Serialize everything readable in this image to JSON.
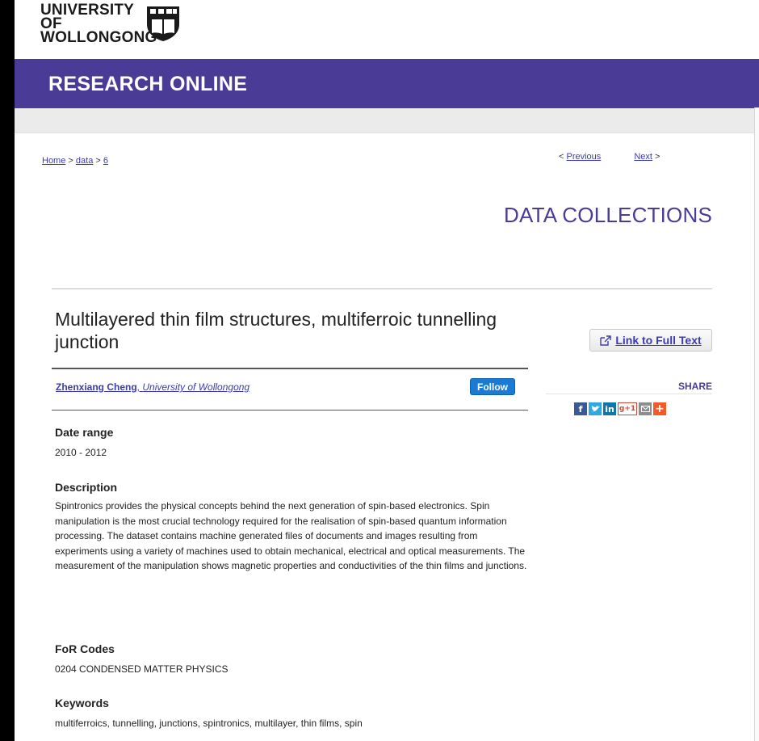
{
  "header": {
    "logo_line1": "UNIVERSITY OF",
    "logo_line2": "WOLLONGONG",
    "banner_title": "RESEARCH ONLINE"
  },
  "breadcrumb": {
    "home": "Home",
    "sep1": ">",
    "data": "data",
    "sep2": ">",
    "item": "6"
  },
  "pager": {
    "prev_prefix": "<",
    "previous": "Previous",
    "next": "Next",
    "next_suffix": ">"
  },
  "section_title": "DATA COLLECTIONS",
  "item": {
    "title": "Multilayered thin film structures, multiferroic tunnelling junction",
    "full_text_label": "Link to Full Text",
    "author_name": "Zhenxiang Cheng",
    "author_sep": ",",
    "author_affil": "University of Wollongong",
    "follow_label": "Follow"
  },
  "share": {
    "label": "SHARE",
    "icons": [
      "facebook-icon",
      "twitter-icon",
      "linkedin-icon",
      "google-plus-icon",
      "email-icon",
      "more-icon"
    ],
    "gplus_text": "g+1",
    "more_text": "+"
  },
  "fields": {
    "date_range_label": "Date range",
    "date_range_value": "2010 - 2012",
    "description_label": "Description",
    "description_value": "Spintronics provides the physical concepts behind the next generation of spin-based electronics. Spin manipulation is the most crucial technology required for the realisation of spin-based quantum information processing. The dataset contains machine generated files of documents and images resulting from experiments using a variety of machines used to obtain mechanical, electrical and optical measurements. The measurement of the manipulation shows magnetic properties and conductivities of the thin films and junctions.",
    "for_codes_label": "FoR Codes",
    "for_codes_value": "0204 CONDENSED MATTER PHYSICS",
    "keywords_label": "Keywords",
    "keywords_value": "multiferroics, tunnelling, junctions, spintronics, multilayer, thin films, spin"
  },
  "colors": {
    "brand_purple": "#4a3c96",
    "link_blue": "#3b3bb3",
    "follow_blue": "#1a7bd6"
  }
}
